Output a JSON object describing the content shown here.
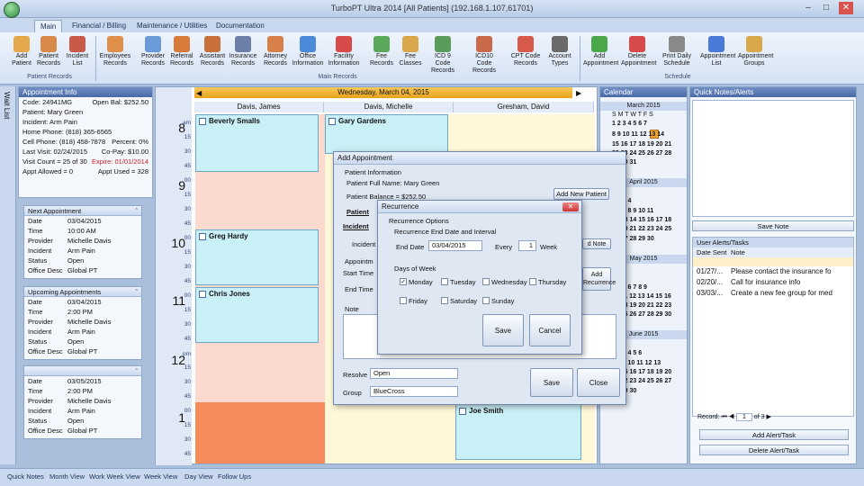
{
  "title_bar": {
    "title": "TurboPT Ultra 2014 [All Patients] (192.168.1.107,61701)"
  },
  "tabs": [
    "Main",
    "Financial / Billing",
    "Maintenance / Utilities",
    "Documentation"
  ],
  "ribbon": {
    "patient_records": [
      "Add Patient",
      "Patient Records",
      "Incident List"
    ],
    "patient_records_label": "Patient Records",
    "main_records": [
      "Employees Records",
      "Provider Records",
      "Referral Records",
      "Assistant Records",
      "Insurance Records",
      "Attorney Records",
      "Office Information",
      "Facility Information",
      "Fee Records",
      "Fee Classes",
      "ICD 9 Code Records",
      "ICD10 Code Records",
      "CPT Code Records",
      "Account Types"
    ],
    "main_records_label": "Main Records",
    "schedule": [
      "Add Appointment",
      "Delete Appointment",
      "Print Daily Schedule",
      "Appointment List",
      "Appointment Groups"
    ],
    "schedule_label": "Schedule"
  },
  "wait_list": "Wait List",
  "appointment_info": {
    "header": "Appointment Info",
    "code": "Code: 24941MG",
    "open_bal": "Open Bal: $252.50",
    "patient": "Patient: Mary Green",
    "incident": "Incident: Arm Pain",
    "home_phone": "Home Phone: (818) 365-6565",
    "cell_phone": "Cell Phone: (818) 458-7878",
    "percent": "Percent: 0%",
    "last_visit": "Last Visit: 02/24/2015",
    "copay": "Co-Pay: $10.00",
    "visit_count": "Visit Count = 25 of 30",
    "expire": "Expire: 01/01/2014",
    "appt_allowed": "Appt Allowed = 0",
    "appt_used": "Appt Used = 328"
  },
  "cards": [
    {
      "header": "Next Appointment",
      "rows": [
        [
          "Date",
          "03/04/2015"
        ],
        [
          "Time",
          "10:00 AM"
        ],
        [
          "Provider",
          "Michelle Davis"
        ],
        [
          "Incident",
          "Arm Pain"
        ],
        [
          "Status",
          "Open"
        ],
        [
          "Office Desc",
          "Global PT"
        ]
      ]
    },
    {
      "header": "Upcoming Appointments",
      "rows": [
        [
          "Date",
          "03/04/2015"
        ],
        [
          "Time",
          "2:00 PM"
        ],
        [
          "Provider",
          "Michelle Davis"
        ],
        [
          "Incident",
          "Arm Pain"
        ],
        [
          "Status",
          "Open"
        ],
        [
          "Office Desc",
          "Global PT"
        ]
      ]
    },
    {
      "header": "",
      "rows": [
        [
          "Date",
          "03/05/2015"
        ],
        [
          "Time",
          "2:00 PM"
        ],
        [
          "Provider",
          "Michelle Davis"
        ],
        [
          "Incident",
          "Arm Pain"
        ],
        [
          "Status",
          "Open"
        ],
        [
          "Office Desc",
          "Global PT"
        ]
      ]
    }
  ],
  "schedule": {
    "date": "Wednesday, March 04, 2015",
    "providers": [
      "Davis, James",
      "Davis, Michelle",
      "Gresham, David"
    ],
    "hours": [
      {
        "h": "8",
        "ap": "am"
      },
      {
        "h": "9",
        "ap": ""
      },
      {
        "h": "10",
        "ap": ""
      },
      {
        "h": "11",
        "ap": ""
      },
      {
        "h": "12",
        "ap": "pm"
      },
      {
        "h": "1",
        "ap": ""
      }
    ],
    "mins": [
      "15",
      "30",
      "45",
      "00"
    ],
    "appts": [
      "Beverly Smalls",
      "Gary Gardens",
      "Greg Hardy",
      "Chris Jones",
      "Joe Smith"
    ]
  },
  "calendar": {
    "header": "Calendar",
    "months": [
      "March 2015",
      "April 2015",
      "May 2015",
      "June 2015"
    ],
    "dow": "S M T W T F S",
    "march": [
      "1 2 3 4 5 6 7",
      "8 9 10 11 12 13 14",
      "15 16 17 18 19 20 21",
      "22 23 24 25 26 27 28",
      "29 30 31"
    ],
    "april": [
      "1 2 3 4",
      "5 6 7 8 9 10 11",
      "12 13 14 15 16 17 18",
      "19 20 21 22 23 24 25",
      "26 27 28 29 30"
    ],
    "may": [
      "1 2",
      "3 4 5 6 7 8 9",
      "10 11 12 13 14 15 16",
      "17 18 19 20 21 22 23",
      "24 25 26 27 28 29 30",
      "31"
    ],
    "june": [
      "1 2 3 4 5 6",
      "7 8 9 10 11 12 13",
      "14 15 16 17 18 19 20",
      "21 22 23 24 25 26 27",
      "28 29 30"
    ]
  },
  "notes": {
    "header": "Quick Notes/Alerts",
    "save_note": "Save Note",
    "alerts_header": "User Alerts/Tasks",
    "col_date": "Date Sent",
    "col_note": "Note",
    "rows": [
      [
        "01/27/...",
        "Please contact the insurance fo"
      ],
      [
        "02/20/...",
        "Call for insurance info"
      ],
      [
        "03/03/...",
        "Create a new fee group for med"
      ]
    ],
    "record_label": "Record:",
    "record_value": "1",
    "record_of": "of 3",
    "add_alert": "Add Alert/Task",
    "delete_alert": "Delete Alert/Task"
  },
  "add_appt": {
    "title": "Add Appointment",
    "patient_info": "Patient Information",
    "full_name": "Patient Full Name: Mary Green",
    "balance": "Patient Balance = $252.50",
    "add_new_patient": "Add New Patient",
    "patient_lbl": "Patient",
    "incident_lbl": "Incident",
    "incident_lbl2": "Incident",
    "appointment_lbl": "Appointm",
    "start_time": "Start Time",
    "end_time": "End Time",
    "add_note": "d Note",
    "add_recurrence": "Add Recurrence",
    "note_lbl": "Note",
    "resolve_lbl": "Resolve",
    "resolve_val": "Open",
    "group_lbl": "Group",
    "group_val": "BlueCross",
    "save": "Save",
    "close": "Close"
  },
  "recurrence": {
    "title": "Recurrence",
    "options": "Recurrence Options",
    "end_interval": "Recurrence End Date and Interval",
    "end_date_lbl": "End Date",
    "end_date_val": "03/04/2015",
    "every_lbl": "Every",
    "every_val": "1",
    "week_lbl": "Week",
    "days_lbl": "Days of Week",
    "days": [
      "Monday",
      "Tuesday",
      "Wednesday",
      "Thursday",
      "Friday",
      "Saturday",
      "Sunday"
    ],
    "save": "Save",
    "cancel": "Cancel"
  },
  "status_views": [
    "Quick Notes",
    "Month View",
    "Work Week View",
    "Week View",
    "Day View",
    "Follow Ups"
  ]
}
